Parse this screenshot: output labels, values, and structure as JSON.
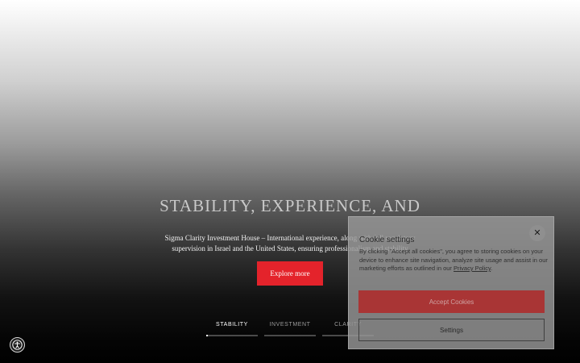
{
  "hero": {
    "title": "STABILITY, EXPERIENCE, AND",
    "subtitle": "Sigma Clarity Investment House – International experience, along with full regulatory supervision in Israel and the United States, ensuring professionalism and stability",
    "cta_label": "Explore more"
  },
  "tabs": [
    {
      "label": "STABILITY",
      "active": true,
      "progress": 0.03
    },
    {
      "label": "INVESTMENT",
      "active": false,
      "progress": 0
    },
    {
      "label": "CLARITY",
      "active": false,
      "progress": 0
    }
  ],
  "accessibility": {
    "icon": "accessibility-icon"
  },
  "cookie": {
    "title": "Cookie settings",
    "close_icon": "close-icon",
    "close_glyph": "✕",
    "text_before": "By clicking \"Accept all cookies\", you agree to storing cookies on your device to enhance site navigation, analyze site usage and assist in our marketing efforts as outlined in our ",
    "link_text": "Privacy Policy",
    "text_after": ".",
    "accept_label": "Accept Cookies",
    "settings_label": "Settings"
  },
  "colors": {
    "accent": "#e4232b",
    "accept_button": "#a93535"
  }
}
